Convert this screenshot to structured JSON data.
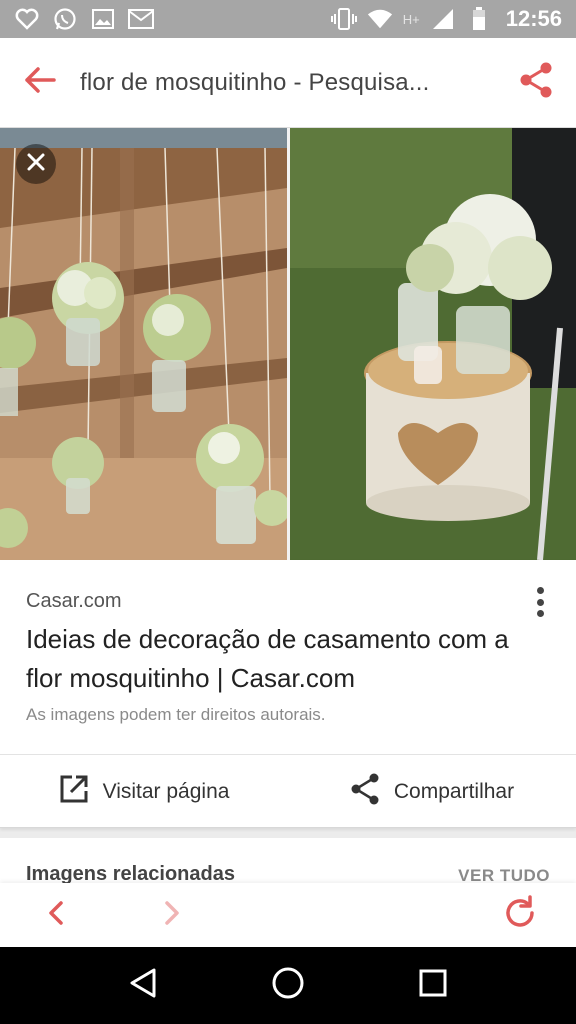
{
  "status_bar": {
    "time": "12:56",
    "network": "H+",
    "icons_left": [
      "heart-icon",
      "whatsapp-icon",
      "image-icon",
      "gmail-icon"
    ],
    "icons_right": [
      "vibrate-icon",
      "wifi-icon",
      "signal-icon",
      "battery-icon"
    ]
  },
  "app_bar": {
    "title": "flor de mosquitinho - Pesquisa...",
    "accent_color": "#e05a5a"
  },
  "image": {
    "description_left": "hanging mason jars with baby's breath flowers",
    "description_right": "birch stump with heart carving and flower jar"
  },
  "result": {
    "source": "Casar.com",
    "title": "Ideias de decoração de casamento com a flor mosquitinho | Casar.com",
    "copyright": "As imagens podem ter direitos autorais.",
    "visit_label": "Visitar página",
    "share_label": "Compartilhar"
  },
  "related": {
    "title": "Imagens relacionadas",
    "see_all": "VER TUDO"
  },
  "browser_bar": {
    "accent_color": "#e05a5a",
    "disabled_color": "#f0b4b4"
  }
}
